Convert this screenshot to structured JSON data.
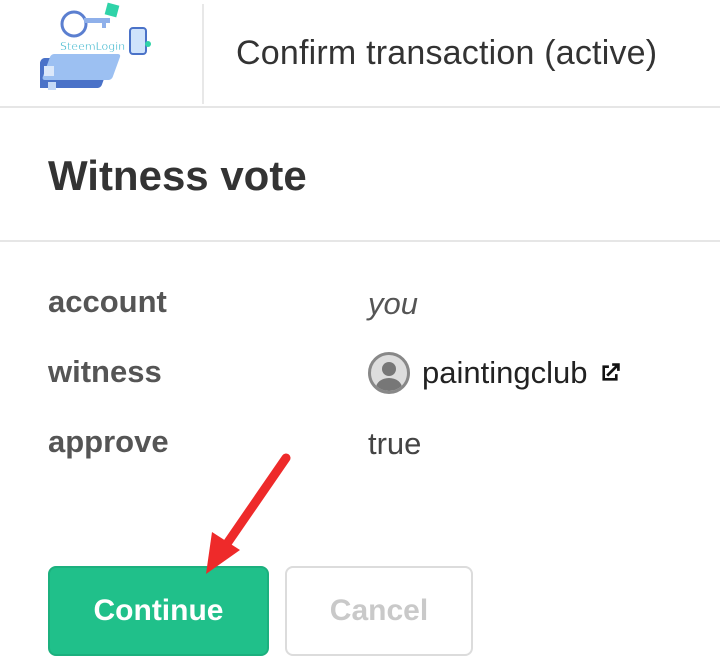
{
  "header": {
    "logo_text": "SteemLogin",
    "title": "Confirm transaction (active)"
  },
  "operation": {
    "title": "Witness vote"
  },
  "fields": {
    "account": {
      "label": "account",
      "value": "you"
    },
    "witness": {
      "label": "witness",
      "value": "paintingclub"
    },
    "approve": {
      "label": "approve",
      "value": "true"
    }
  },
  "buttons": {
    "continue": "Continue",
    "cancel": "Cancel"
  },
  "colors": {
    "primary": "#20c08a",
    "annotation_arrow": "#ee2a2a"
  },
  "icons": {
    "avatar": "user-avatar-icon",
    "external_link": "external-link-icon",
    "annotation": "red-arrow-icon"
  }
}
